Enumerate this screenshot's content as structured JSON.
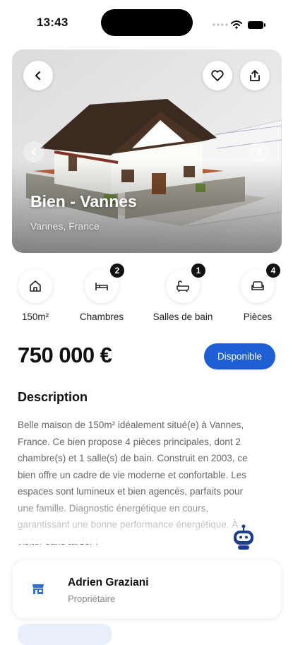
{
  "status_bar": {
    "time": "13:43"
  },
  "hero": {
    "title": "Bien - Vannes",
    "location": "Vannes, France",
    "back_icon": "chevron-left-icon",
    "favorite_icon": "heart-icon",
    "share_icon": "share-icon"
  },
  "features": [
    {
      "icon": "home-icon",
      "label": "150m²",
      "badge": null
    },
    {
      "icon": "bed-icon",
      "label": "Chambres",
      "badge": "2"
    },
    {
      "icon": "bath-icon",
      "label": "Salles de bain",
      "badge": "1"
    },
    {
      "icon": "sofa-icon",
      "label": "Pièces",
      "badge": "4"
    }
  ],
  "price": "750 000 €",
  "availability": "Disponible",
  "description": {
    "title": "Description",
    "text": "Belle maison de 150m² idéalement situé(e) à Vannes, France. Ce bien propose 4 pièces principales, dont 2 chambre(s) et 1 salle(s) de bain. Construit en 2003, ce bien offre un cadre de vie moderne et confortable. Les espaces sont lumineux et bien agencés, parfaits pour une famille. Diagnostic énergétique en cours, garantissant une bonne performance énergétique. À visiter sans tarder !"
  },
  "owner": {
    "name": "Adrien Graziani",
    "role": "Propriétaire"
  },
  "colors": {
    "accent": "#1f5fd6",
    "badge": "#111111"
  }
}
